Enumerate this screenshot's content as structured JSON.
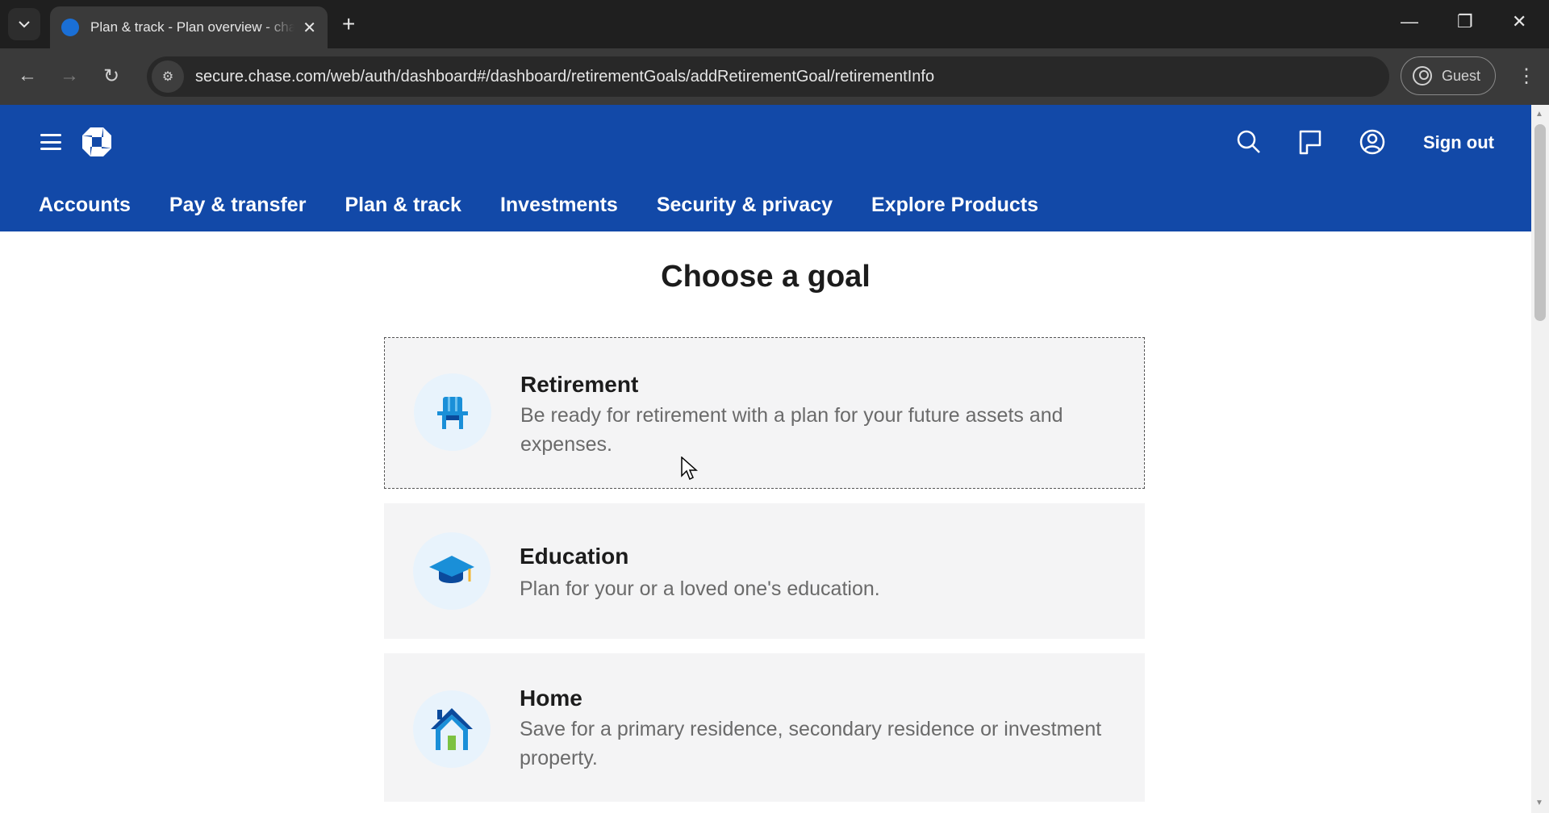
{
  "browser": {
    "tab_title": "Plan & track - Plan overview - chase.com",
    "url": "secure.chase.com/web/auth/dashboard#/dashboard/retirementGoals/addRetirementGoal/retirementInfo",
    "profile_label": "Guest"
  },
  "header": {
    "sign_out_label": "Sign out",
    "nav": [
      "Accounts",
      "Pay & transfer",
      "Plan & track",
      "Investments",
      "Security & privacy",
      "Explore Products"
    ]
  },
  "page": {
    "title": "Choose a goal",
    "goals": [
      {
        "title": "Retirement",
        "description": "Be ready for retirement with a plan for your future assets and expenses.",
        "icon": "retirement-chair-icon"
      },
      {
        "title": "Education",
        "description": "Plan for your or a loved one's education.",
        "icon": "graduation-cap-icon"
      },
      {
        "title": "Home",
        "description": "Save for a primary residence, secondary residence or investment property.",
        "icon": "house-icon"
      }
    ]
  },
  "colors": {
    "brand_blue": "#1249a8",
    "card_bg": "#f4f4f5"
  }
}
